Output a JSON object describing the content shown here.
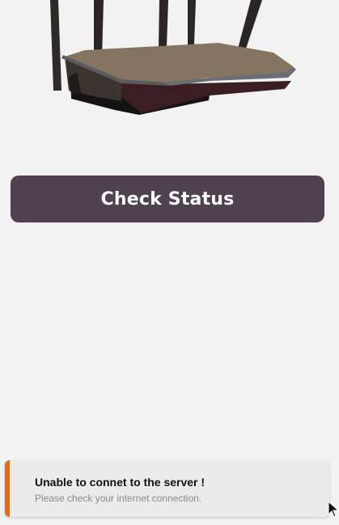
{
  "main": {
    "router_image_icon": "router-icon",
    "check_status_label": "Check Status"
  },
  "toast": {
    "title": "Unable to connet to the server !",
    "message": "Please check your internet connection.",
    "accent_color": "#e8670f"
  },
  "colors": {
    "background": "#f2f2f2",
    "button": "#4f4150",
    "button_text": "#ffffff"
  }
}
